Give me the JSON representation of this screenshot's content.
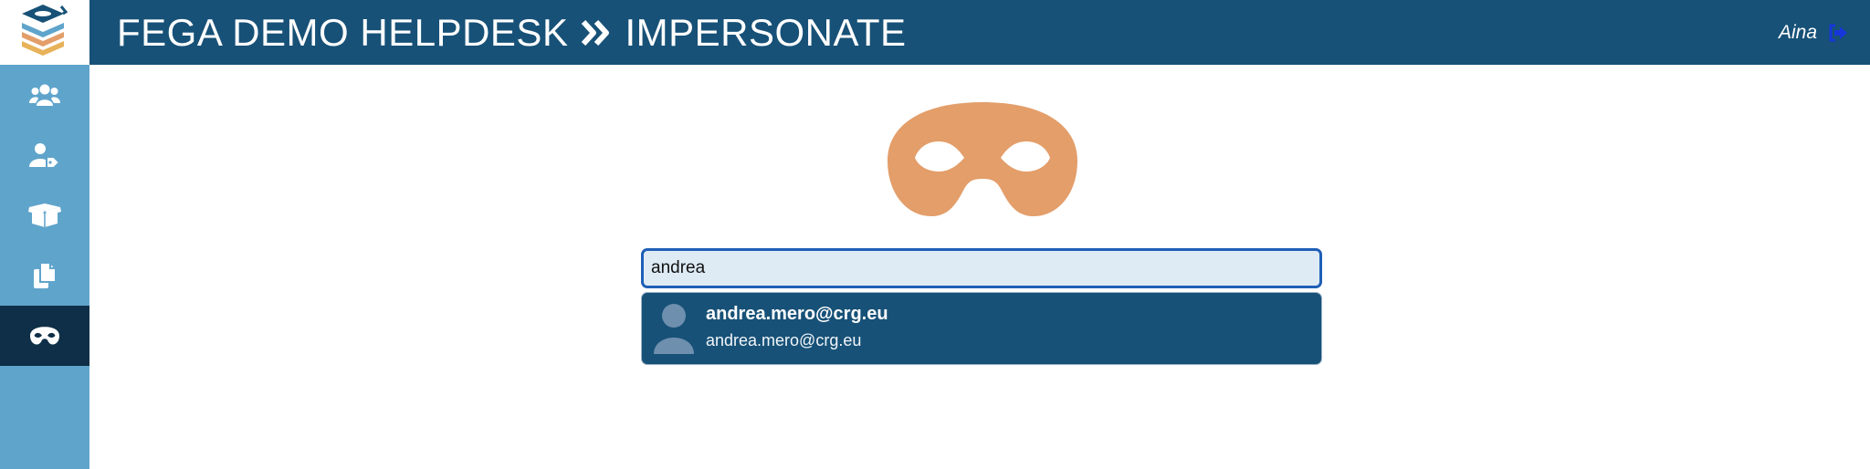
{
  "header": {
    "title_main": "FEGA DEMO HELPDESK",
    "title_section": "IMPERSONATE",
    "user_name": "Aina",
    "colors": {
      "bar": "#175177",
      "logout_icon": "#1636d9"
    }
  },
  "logo": {
    "icon": "layered-stack-logo-icon"
  },
  "sidebar": {
    "items": [
      {
        "icon": "users-icon",
        "active": false
      },
      {
        "icon": "user-tag-icon",
        "active": false
      },
      {
        "icon": "open-box-icon",
        "active": false
      },
      {
        "icon": "copy-documents-icon",
        "active": false
      },
      {
        "icon": "mask-icon",
        "active": true
      }
    ],
    "colors": {
      "background": "#5fa4cb",
      "active": "#0e2f47"
    }
  },
  "main": {
    "hero_icon": "mask-icon",
    "hero_color": "#e39e6a",
    "search": {
      "value": "andrea",
      "placeholder": ""
    },
    "suggestions": [
      {
        "primary": "andrea.mero@crg.eu",
        "secondary": "andrea.mero@crg.eu",
        "icon": "user-avatar-icon"
      }
    ]
  }
}
